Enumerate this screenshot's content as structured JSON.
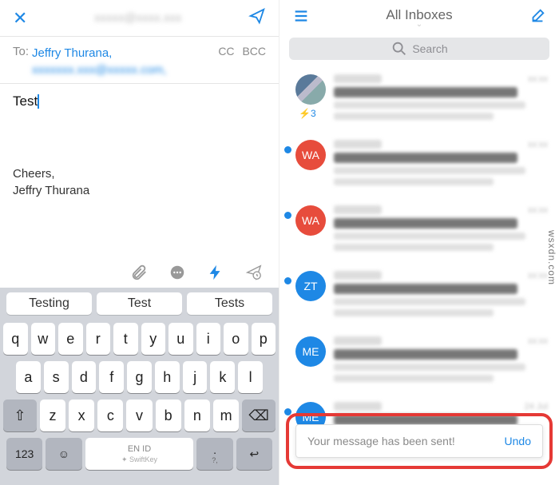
{
  "left": {
    "header": {
      "close": "✕",
      "from_blur": "xxxxx@xxxx.xxx"
    },
    "to": {
      "label": "To:",
      "recipient": "Jeffry Thurana,",
      "blur_recipient": "xxxxxxx.xxx@xxxxx.com,",
      "cc": "CC",
      "bcc": "BCC"
    },
    "body": "Test",
    "signature_1": "Cheers,",
    "signature_2": "Jeffry Thurana"
  },
  "keyboard": {
    "suggestions": [
      "Testing",
      "Test",
      "Tests"
    ],
    "row1": [
      "q",
      "w",
      "e",
      "r",
      "t",
      "y",
      "u",
      "i",
      "o",
      "p"
    ],
    "row2": [
      "a",
      "s",
      "d",
      "f",
      "g",
      "h",
      "j",
      "k",
      "l"
    ],
    "row3": [
      "z",
      "x",
      "c",
      "v",
      "b",
      "n",
      "m"
    ],
    "shift": "⇧",
    "del": "⌫",
    "num": "123",
    "emoji": "☺",
    "space_lang": "EN ID",
    "space_brand": "✦ SwiftKey",
    "punct": ".",
    "punct_sub": "?,",
    "enter": "↩"
  },
  "right": {
    "header": {
      "title": "All Inboxes"
    },
    "search": {
      "placeholder": "Search"
    },
    "rows": [
      {
        "avatar_type": "img",
        "avatar_text": "",
        "unread": false,
        "thunder": "⚡3"
      },
      {
        "avatar_type": "red",
        "avatar_text": "WA",
        "unread": true
      },
      {
        "avatar_type": "red",
        "avatar_text": "WA",
        "unread": true
      },
      {
        "avatar_type": "blue",
        "avatar_text": "ZT",
        "unread": true
      },
      {
        "avatar_type": "blue",
        "avatar_text": "ME",
        "unread": false
      },
      {
        "avatar_type": "blue",
        "avatar_text": "ME",
        "unread": true,
        "time": "24 Jul"
      }
    ],
    "toast": {
      "msg": "Your message has been sent!",
      "undo": "Undo"
    }
  },
  "watermark": "wsxdn.com"
}
